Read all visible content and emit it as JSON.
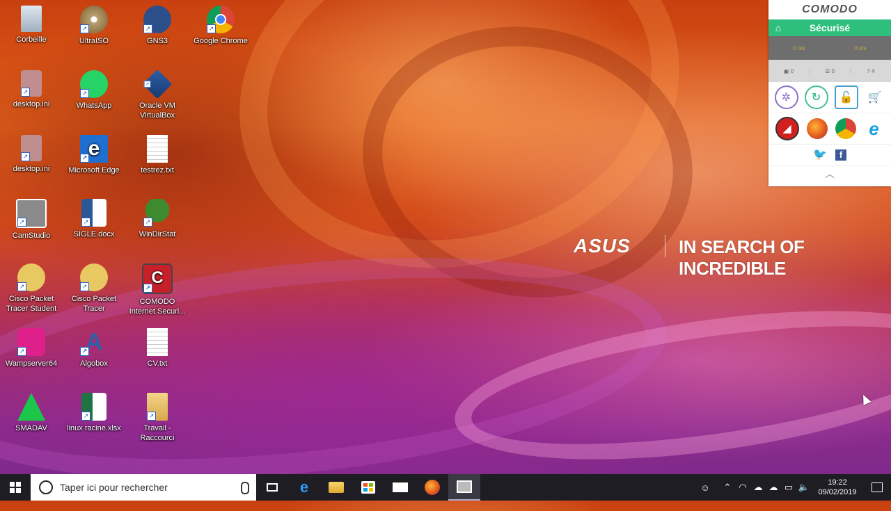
{
  "desktop": {
    "icons": [
      {
        "label": "Corbeille",
        "icon": "recycle-bin-icon"
      },
      {
        "label": "UltraISO",
        "icon": "disc-icon"
      },
      {
        "label": "GNS3",
        "icon": "gns3-icon"
      },
      {
        "label": "Google Chrome",
        "icon": "chrome-icon"
      },
      {
        "label": "desktop.ini",
        "icon": "settings-file-icon"
      },
      {
        "label": "WhatsApp",
        "icon": "whatsapp-icon"
      },
      {
        "label": "Oracle VM VirtualBox",
        "icon": "virtualbox-icon"
      },
      {
        "label": "desktop.ini",
        "icon": "settings-file-icon"
      },
      {
        "label": "Microsoft Edge",
        "icon": "edge-icon"
      },
      {
        "label": "testrez.txt",
        "icon": "text-file-icon"
      },
      {
        "label": "CamStudio",
        "icon": "camera-icon"
      },
      {
        "label": "SIGLE.docx",
        "icon": "word-icon"
      },
      {
        "label": "WinDirStat",
        "icon": "tree-icon"
      },
      {
        "label": "Cisco Packet Tracer Student",
        "icon": "packet-tracer-icon"
      },
      {
        "label": "Cisco Packet Tracer",
        "icon": "packet-tracer-icon"
      },
      {
        "label": "COMODO Internet Securi...",
        "icon": "comodo-icon"
      },
      {
        "label": "Wampserver64",
        "icon": "wamp-icon"
      },
      {
        "label": "Algobox",
        "icon": "algobox-icon"
      },
      {
        "label": "CV.txt",
        "icon": "text-file-icon"
      },
      {
        "label": "SMADAV",
        "icon": "smadav-icon"
      },
      {
        "label": "linux racine.xlsx",
        "icon": "excel-icon"
      },
      {
        "label": "Travail - Raccourci",
        "icon": "folder-icon"
      }
    ]
  },
  "wallpaper": {
    "brand": "ASUS",
    "slogan": "IN SEARCH OF INCREDIBLE"
  },
  "comodo": {
    "brand": "COMODO",
    "status": "Sécurisé",
    "speed_down": "0 o/s",
    "speed_up": "0 o/s",
    "count_1": "0",
    "count_2": "0",
    "count_3": "4"
  },
  "taskbar": {
    "search_placeholder": "Taper ici pour rechercher",
    "time": "19:22",
    "date": "09/02/2019"
  },
  "colors": {
    "comodo_green": "#2fbf7c",
    "taskbar_bg": "#1d1d23"
  }
}
